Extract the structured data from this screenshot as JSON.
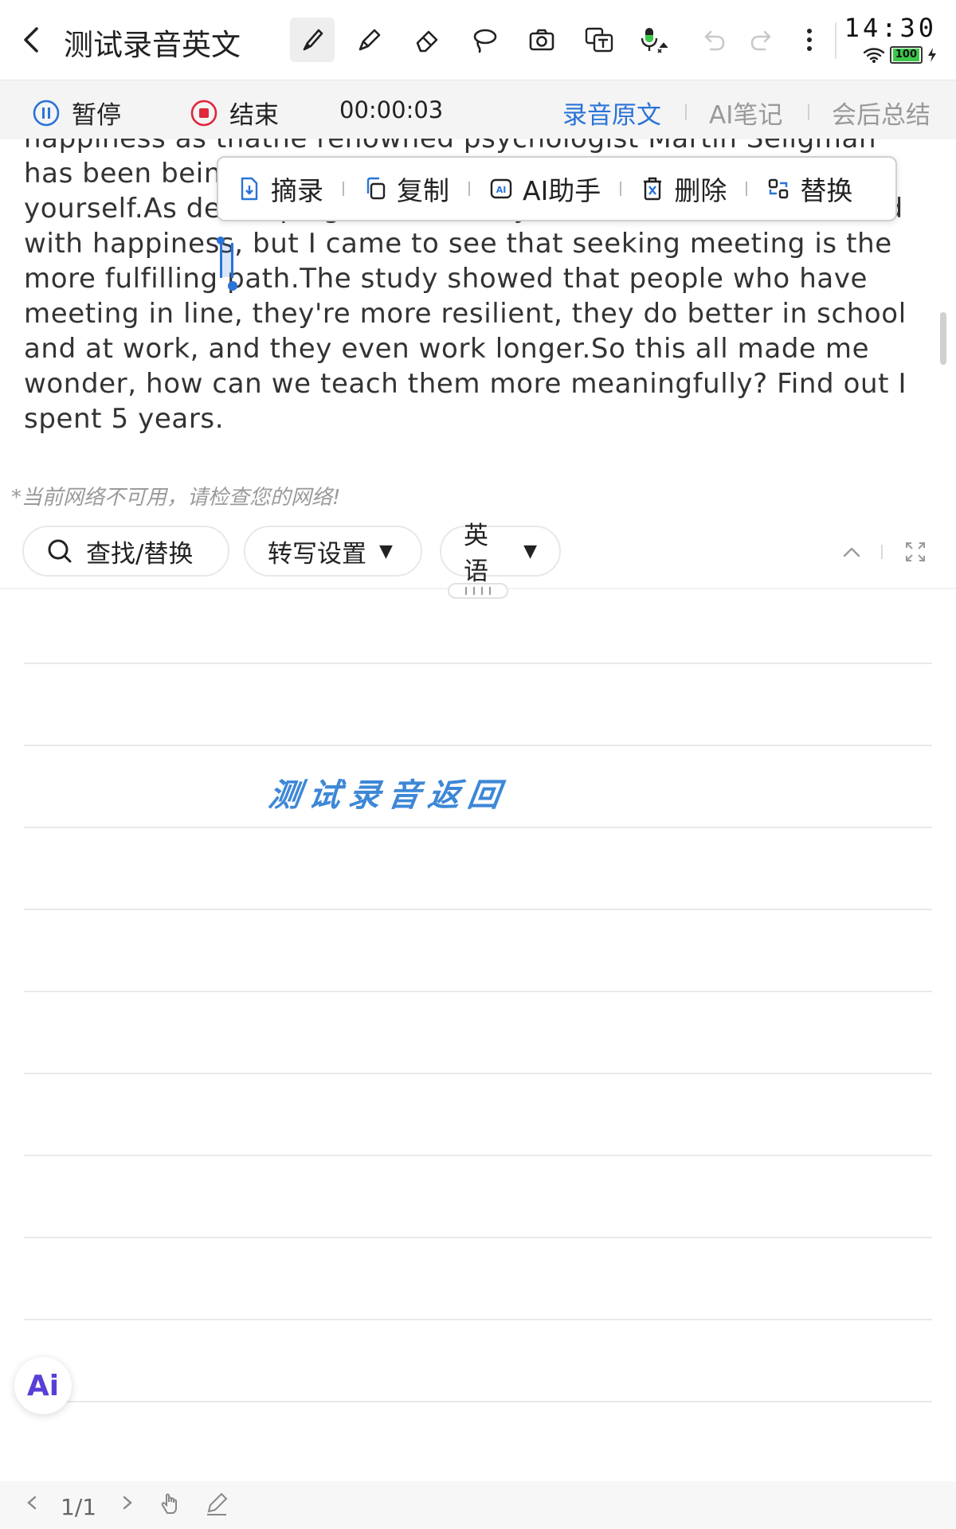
{
  "header": {
    "title": "测试录音英文",
    "icons": [
      "back-icon",
      "brush-icon",
      "pen-icon",
      "eraser-icon",
      "lasso-icon",
      "camera-icon",
      "translate-icon",
      "mic-icon",
      "undo-icon",
      "redo-icon",
      "more-icon"
    ],
    "clock": "14:30",
    "battery": "100"
  },
  "recording_bar": {
    "pause_label": "暂停",
    "stop_label": "结束",
    "timer": "00:00:03",
    "tabs": [
      {
        "label": "录音原文",
        "active": true
      },
      {
        "label": "AI笔记",
        "active": false
      },
      {
        "label": "会后总结",
        "active": false
      }
    ]
  },
  "transcript": {
    "lines": [
      "happiness as thathe renowned psychologist Martin Seligman",
      "has been being that, Martin Seligman has been telling",
      "yourself.As developing that, thank you.Our culture is obsessed",
      "with happiness, but I came to see that seeking meeting is the",
      "more fulfilling path.The study showed that people who have",
      "meeting in line, they're more resilient, they do better in school",
      "and at work, and they even work longer.So this all made me",
      "wonder, how can we teach them more meaningfully? Find out I",
      "spent 5 years."
    ]
  },
  "context_menu": {
    "items": [
      {
        "label": "摘录",
        "icon": "excerpt-icon"
      },
      {
        "label": "复制",
        "icon": "copy-icon"
      },
      {
        "label": "AI助手",
        "icon": "ai-assistant-icon"
      },
      {
        "label": "删除",
        "icon": "delete-icon"
      },
      {
        "label": "替换",
        "icon": "replace-icon"
      }
    ]
  },
  "network_warning": "*当前网络不可用，请检查您的网络!",
  "controls": {
    "find_replace": "查找/替换",
    "transcribe_settings": "转写设置",
    "language": "英语"
  },
  "notebook": {
    "handwriting": "测试录音返回"
  },
  "ai_button": "Ai",
  "footer": {
    "page": "1/1"
  },
  "colors": {
    "accent": "#2a73d8",
    "record_red": "#e0263a",
    "handwriting": "#3d87d6"
  }
}
